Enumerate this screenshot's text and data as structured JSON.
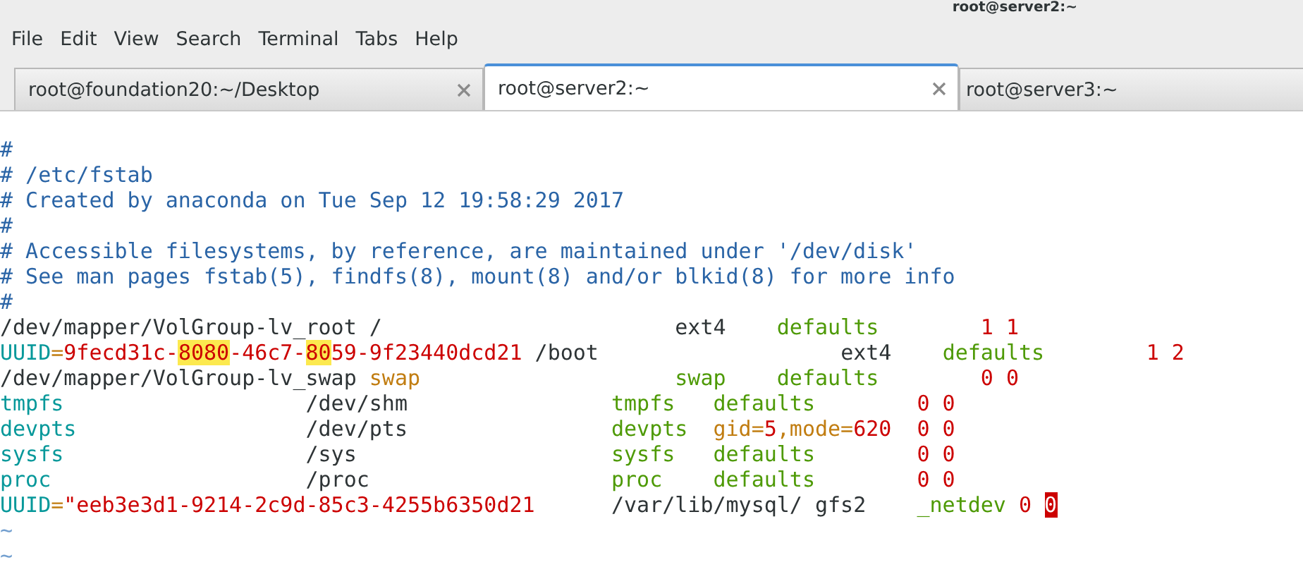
{
  "window": {
    "title": "root@server2:~"
  },
  "menu": [
    "File",
    "Edit",
    "View",
    "Search",
    "Terminal",
    "Tabs",
    "Help"
  ],
  "tabs": [
    {
      "label": "root@foundation20:~/Desktop",
      "selected": false,
      "closable": true
    },
    {
      "label": "root@server2:~",
      "selected": true,
      "closable": true
    },
    {
      "label": "root@server3:~",
      "selected": false,
      "closable": false
    }
  ],
  "editor": {
    "lines": [
      [
        {
          "text": "#",
          "kind": "comment"
        }
      ],
      [
        {
          "text": "# /etc/fstab",
          "kind": "comment"
        }
      ],
      [
        {
          "text": "# Created by anaconda on Tue Sep 12 19:58:29 2017",
          "kind": "comment"
        }
      ],
      [
        {
          "text": "#",
          "kind": "comment"
        }
      ],
      [
        {
          "text": "# Accessible filesystems, by reference, are maintained under '/dev/disk'",
          "kind": "comment"
        }
      ],
      [
        {
          "text": "# See man pages fstab(5), findfs(8), mount(8) and/or blkid(8) for more info",
          "kind": "comment"
        }
      ],
      [
        {
          "text": "#",
          "kind": "comment"
        }
      ],
      [
        {
          "text": "/dev/mapper/VolGroup-lv_root /                       ",
          "kind": "text"
        },
        {
          "text": "ext4    ",
          "kind": "text"
        },
        {
          "text": "defaults        ",
          "kind": "type"
        },
        {
          "text": "1 1",
          "kind": "string"
        }
      ],
      [
        {
          "text": "UUID",
          "kind": "keyword"
        },
        {
          "text": "=",
          "kind": "special"
        },
        {
          "text": "9fecd31c-",
          "kind": "string"
        },
        {
          "text": "8080",
          "kind": "match"
        },
        {
          "text": "-46c7-",
          "kind": "string"
        },
        {
          "text": "80",
          "kind": "match"
        },
        {
          "text": "59-9f23440dcd21",
          "kind": "string"
        },
        {
          "text": " /boot                   ",
          "kind": "text"
        },
        {
          "text": "ext4    ",
          "kind": "text"
        },
        {
          "text": "defaults        ",
          "kind": "type"
        },
        {
          "text": "1 2",
          "kind": "string"
        }
      ],
      [
        {
          "text": "/dev/mapper/VolGroup-lv_swap ",
          "kind": "text"
        },
        {
          "text": "swap                    ",
          "kind": "special"
        },
        {
          "text": "swap    defaults        ",
          "kind": "type"
        },
        {
          "text": "0 0",
          "kind": "string"
        }
      ],
      [
        {
          "text": "tmpfs                   ",
          "kind": "keyword"
        },
        {
          "text": "/dev/shm                ",
          "kind": "text"
        },
        {
          "text": "tmpfs   defaults        ",
          "kind": "type"
        },
        {
          "text": "0 0",
          "kind": "string"
        }
      ],
      [
        {
          "text": "devpts                  ",
          "kind": "keyword"
        },
        {
          "text": "/dev/pts                ",
          "kind": "text"
        },
        {
          "text": "devpts  ",
          "kind": "type"
        },
        {
          "text": "gid=",
          "kind": "special"
        },
        {
          "text": "5",
          "kind": "string"
        },
        {
          "text": ",mode=",
          "kind": "special"
        },
        {
          "text": "620  ",
          "kind": "string"
        },
        {
          "text": "0 0",
          "kind": "string"
        }
      ],
      [
        {
          "text": "sysfs                   ",
          "kind": "keyword"
        },
        {
          "text": "/sys                    ",
          "kind": "text"
        },
        {
          "text": "sysfs   defaults        ",
          "kind": "type"
        },
        {
          "text": "0 0",
          "kind": "string"
        }
      ],
      [
        {
          "text": "proc                    ",
          "kind": "keyword"
        },
        {
          "text": "/proc                   ",
          "kind": "text"
        },
        {
          "text": "proc    defaults        ",
          "kind": "type"
        },
        {
          "text": "0 0",
          "kind": "string"
        }
      ],
      [
        {
          "text": "UUID",
          "kind": "keyword"
        },
        {
          "text": "=",
          "kind": "special"
        },
        {
          "text": "\"eeb3e3d1-9214-2c9d-85c3-4255b6350d21      ",
          "kind": "string"
        },
        {
          "text": "/var/lib/mysql/ gfs2    ",
          "kind": "text"
        },
        {
          "text": "_netdev ",
          "kind": "type"
        },
        {
          "text": "0 ",
          "kind": "string"
        },
        {
          "text": "0",
          "kind": "cursor"
        }
      ],
      [
        {
          "text": "~",
          "kind": "tilde"
        }
      ],
      [
        {
          "text": "~",
          "kind": "tilde"
        }
      ]
    ]
  }
}
